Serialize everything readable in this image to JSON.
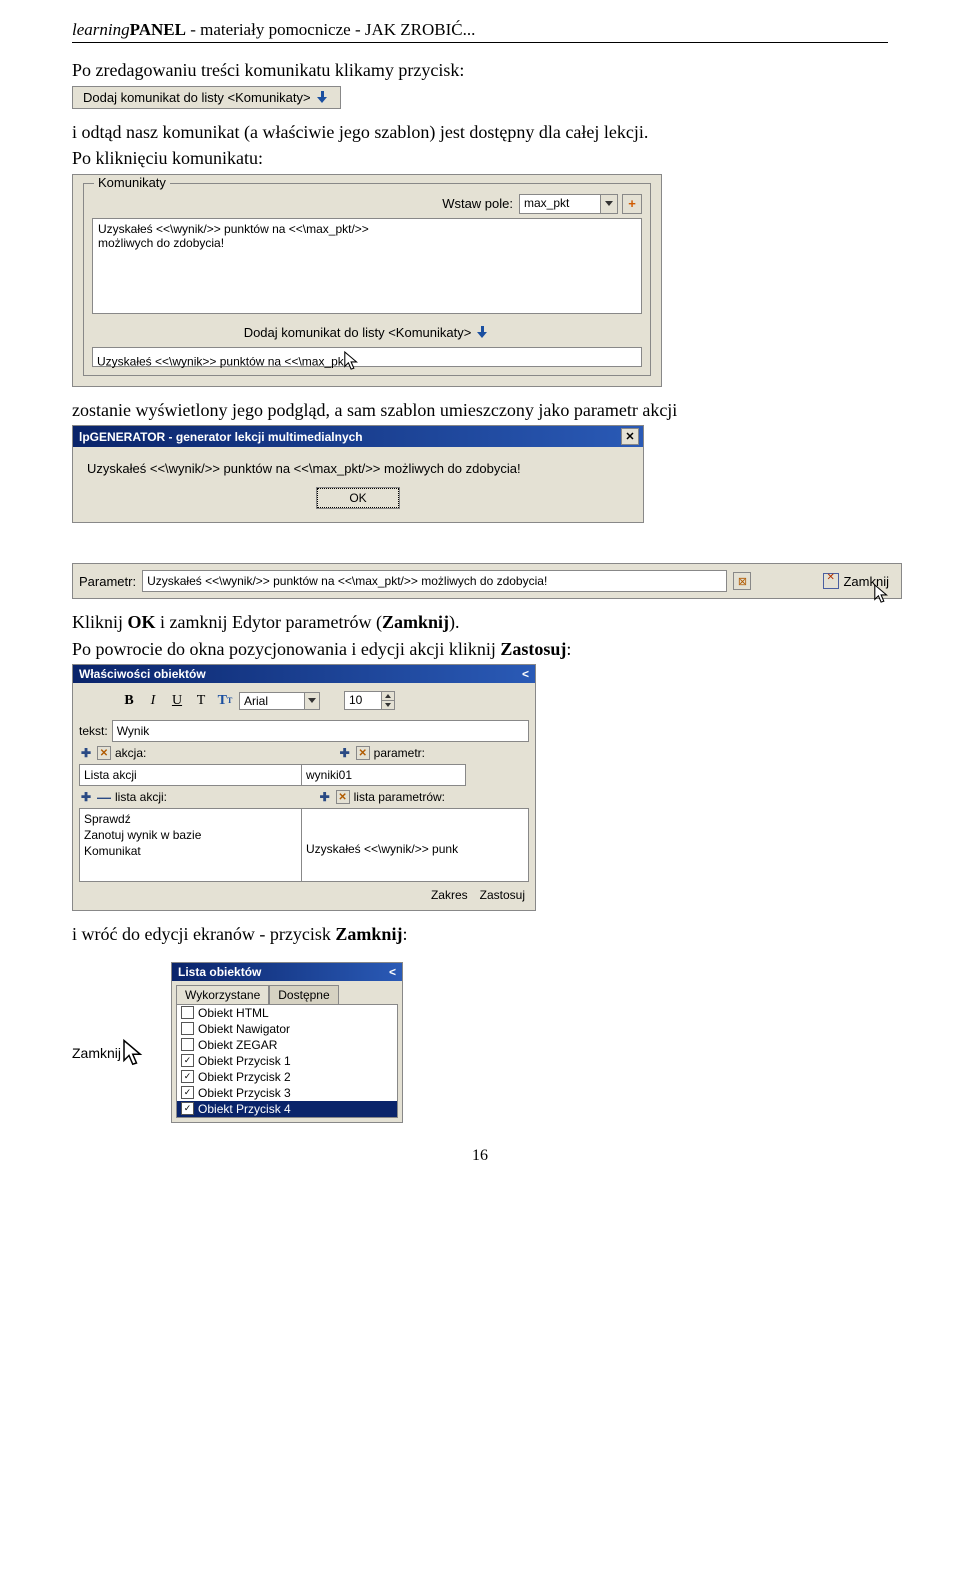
{
  "header": {
    "learning": "learning",
    "panel": "PANEL",
    "rest": " - materiały pomocnicze - JAK ZROBIĆ..."
  },
  "p1": "Po zredagowaniu treści komunikatu klikamy przycisk:",
  "ss1": {
    "label": "Dodaj komunikat do listy <Komunikaty>"
  },
  "p2": "i odtąd nasz komunikat (a właściwie jego szablon) jest dostępny dla całej lekcji.",
  "p3": "Po kliknięciu komunikatu:",
  "ss2": {
    "legend": "Komunikaty",
    "wstaw_label": "Wstaw pole:",
    "wstaw_value": "max_pkt",
    "textarea_text": "Uzyskałeś <<\\wynik/>> punktów na <<\\max_pkt/>>\nmożliwych do zdobycia!",
    "add_label": "Dodaj komunikat do listy <Komunikaty>",
    "bottom_value": "Uzyskałeś <<\\wynik>> punktów na <<\\max_pk"
  },
  "p4": "zostanie wyświetlony jego podgląd, a sam szablon umieszczony jako parametr akcji",
  "ss3": {
    "title": "lpGENERATOR - generator lekcji multimedialnych",
    "message": "Uzyskałeś <<\\wynik/>> punktów na <<\\max_pkt/>> możliwych do zdobycia!",
    "ok": "OK"
  },
  "ss4": {
    "label": "Parametr:",
    "value": "Uzyskałeś <<\\wynik/>> punktów na <<\\max_pkt/>> możliwych do zdobycia!",
    "zamknij": "Zamknij"
  },
  "p5a": "Kliknij ",
  "p5b": "OK",
  "p5c": " i zamknij Edytor parametrów (",
  "p5d": "Zamknij",
  "p5e": ").",
  "p6a": "Po powrocie do okna pozycjonowania i edycji akcji kliknij ",
  "p6b": "Zastosuj",
  "p6c": ":",
  "ss5": {
    "title": "Właściwości obiektów",
    "font": "Arial",
    "size": "10",
    "tekst_label": "tekst:",
    "tekst_value": "Wynik",
    "akcja_label": "akcja:",
    "parametr_label": "parametr:",
    "lista_akcji": "Lista akcji",
    "wyniki": "wyniki01",
    "lista_akcji_label": "lista akcji:",
    "lista_param_label": "lista parametrów:",
    "list_left": [
      "Sprawdź",
      "Zanotuj wynik w bazie",
      "Komunikat"
    ],
    "list_right_value": "Uzyskałeś <<\\wynik/>> punk",
    "zakres": "Zakres",
    "zastosuj": "Zastosuj"
  },
  "p7a": "i wróć do edycji ekranów - przycisk ",
  "p7b": "Zamknij",
  "p7c": ":",
  "ss6": {
    "left_label": "Zamknij",
    "title": "Lista obiektów",
    "tab1": "Wykorzystane",
    "tab2": "Dostępne",
    "items": [
      {
        "checked": false,
        "label": "Obiekt HTML"
      },
      {
        "checked": false,
        "label": "Obiekt Nawigator"
      },
      {
        "checked": false,
        "label": "Obiekt ZEGAR"
      },
      {
        "checked": true,
        "label": "Obiekt Przycisk 1"
      },
      {
        "checked": true,
        "label": "Obiekt Przycisk 2"
      },
      {
        "checked": true,
        "label": "Obiekt Przycisk 3"
      },
      {
        "checked": true,
        "label": "Obiekt Przycisk 4",
        "selected": true
      }
    ]
  },
  "pagenum": "16"
}
